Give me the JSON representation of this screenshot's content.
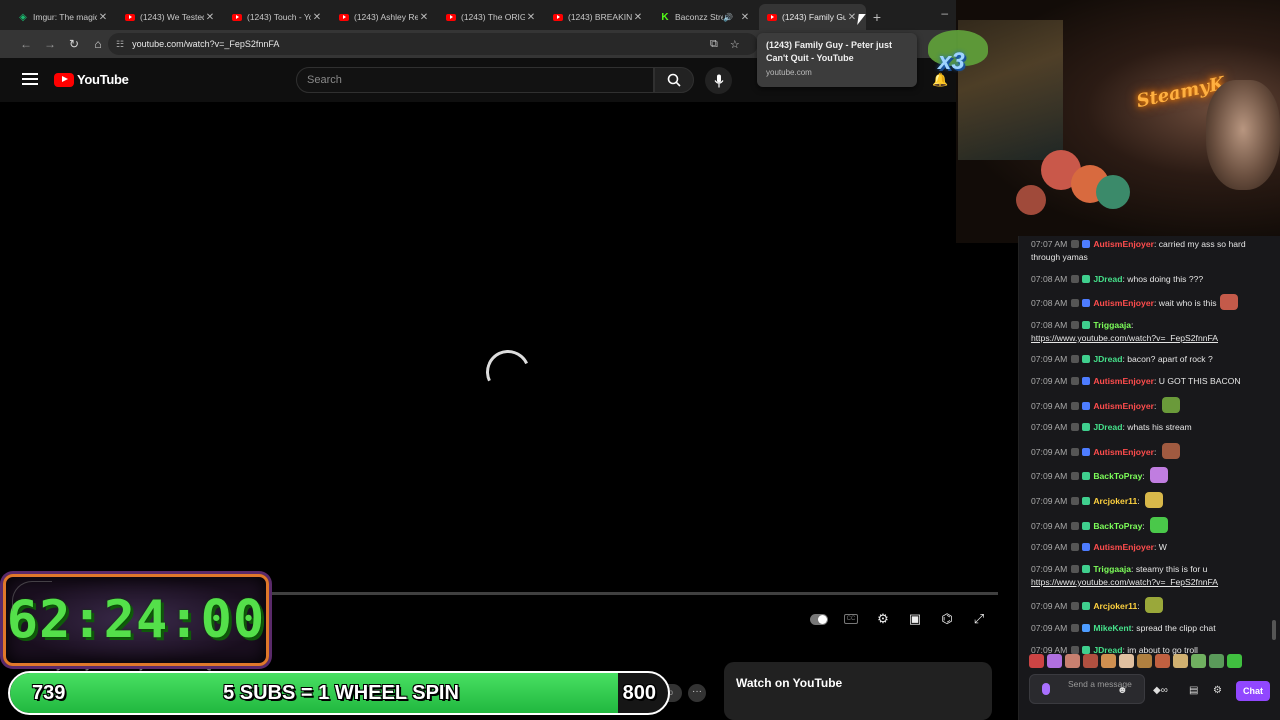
{
  "browser": {
    "tabs": [
      {
        "title": "Imgur: The magic",
        "favicon": "imgur-icon",
        "active": false
      },
      {
        "title": "(1243) We Tested",
        "favicon": "youtube-icon",
        "active": false
      },
      {
        "title": "(1243) Touch - Yo",
        "favicon": "youtube-icon",
        "active": false
      },
      {
        "title": "(1243) Ashley Re",
        "favicon": "youtube-icon",
        "active": false
      },
      {
        "title": "(1243) The ORIGI",
        "favicon": "youtube-icon",
        "active": false
      },
      {
        "title": "(1243) BREAKIN",
        "favicon": "youtube-icon",
        "active": false
      },
      {
        "title": "Baconzz Stre",
        "favicon": "kick-icon",
        "active": false,
        "audio": true
      },
      {
        "title": "(1243) Family Gu",
        "favicon": "youtube-icon",
        "active": true
      }
    ],
    "new_tab": "+",
    "minimize": "–",
    "url": "youtube.com/watch?v=_FepS2fnnFA"
  },
  "tooltip": {
    "title": "(1243) Family Guy - Peter just Can't Quit - YouTube",
    "domain": "youtube.com"
  },
  "youtube": {
    "logo_text": "YouTube",
    "search_placeholder": "Search",
    "video_title": "Family Guy - Peter just Can't Quit",
    "watch_on_youtube": "Watch on YouTube",
    "clip_label": "Clip",
    "more": "···"
  },
  "overlay": {
    "webcam_sign": "SteamyK",
    "emote_multiplier": "x3",
    "timer": "62:24:00",
    "subs_current": "739",
    "subs_goal_text": "5 SUBS = 1 WHEEL SPIN",
    "subs_target": "800",
    "subs_progress": 0.924
  },
  "chat": {
    "messages": [
      {
        "time": "07:07 AM",
        "user": "AutismEnjoyer",
        "color": "#ff4d4d",
        "badge": "#4d7cff",
        "text": "carried my ass so hard through yamas"
      },
      {
        "time": "07:08 AM",
        "user": "JDread",
        "color": "#45e08a",
        "badge": "#3fcf8e",
        "text": "whos doing this ???"
      },
      {
        "time": "07:08 AM",
        "user": "AutismEnjoyer",
        "color": "#ff4d4d",
        "badge": "#4d7cff",
        "text": "wait who is this",
        "emote": "#c45a4a"
      },
      {
        "time": "07:08 AM",
        "user": "Triggaaja",
        "color": "#7dff5a",
        "badge": "#3fcf8e",
        "text": "",
        "link": "https://www.youtube.com/watch?v=_FepS2fnnFA"
      },
      {
        "time": "07:09 AM",
        "user": "JDread",
        "color": "#45e08a",
        "badge": "#3fcf8e",
        "text": "bacon? apart of rock ?"
      },
      {
        "time": "07:09 AM",
        "user": "AutismEnjoyer",
        "color": "#ff4d4d",
        "badge": "#4d7cff",
        "text": "U GOT THIS BACON"
      },
      {
        "time": "07:09 AM",
        "user": "AutismEnjoyer",
        "color": "#ff4d4d",
        "badge": "#4d7cff",
        "text": "",
        "emote": "#6a9a3a"
      },
      {
        "time": "07:09 AM",
        "user": "JDread",
        "color": "#45e08a",
        "badge": "#3fcf8e",
        "text": "whats his stream"
      },
      {
        "time": "07:09 AM",
        "user": "AutismEnjoyer",
        "color": "#ff4d4d",
        "badge": "#4d7cff",
        "text": "",
        "emote": "#a05a40"
      },
      {
        "time": "07:09 AM",
        "user": "BackToPray",
        "color": "#7dff5a",
        "badge": "#3fcf8e",
        "text": "",
        "emote": "#c07de0"
      },
      {
        "time": "07:09 AM",
        "user": "Arcjoker11",
        "color": "#ffd23f",
        "badge": "#3fcf8e",
        "text": "",
        "emote": "#d8b84a"
      },
      {
        "time": "07:09 AM",
        "user": "BackToPray",
        "color": "#7dff5a",
        "badge": "#3fcf8e",
        "text": "",
        "emote": "#4ac84a"
      },
      {
        "time": "07:09 AM",
        "user": "AutismEnjoyer",
        "color": "#ff4d4d",
        "badge": "#4d7cff",
        "text": "W"
      },
      {
        "time": "07:09 AM",
        "user": "Triggaaja",
        "color": "#7dff5a",
        "badge": "#3fcf8e",
        "text": "steamy this is for u",
        "link": "https://www.youtube.com/watch?v=_FepS2fnnFA"
      },
      {
        "time": "07:09 AM",
        "user": "Arcjoker11",
        "color": "#ffd23f",
        "badge": "#3fcf8e",
        "text": "",
        "emote": "#9aa83a"
      },
      {
        "time": "07:09 AM",
        "user": "MikeKent",
        "color": "#45e08a",
        "badge": "#4d9cff",
        "text": "spread the clipp chat"
      },
      {
        "time": "07:09 AM",
        "user": "JDread",
        "color": "#45e08a",
        "badge": "#3fcf8e",
        "text": "im about to go troll"
      }
    ],
    "input_placeholder": "Send a message",
    "chat_button": "Chat",
    "emote_bar_colors": [
      "#c44",
      "#b070e0",
      "#c88070",
      "#b05040",
      "#d09050",
      "#e0c0a0",
      "#b08040",
      "#c06040",
      "#d0b070",
      "#70b060",
      "#5a9a5a",
      "#40c040"
    ]
  },
  "colors": {
    "youtube_red": "#ff0000",
    "subs_green": "#2ecc4a",
    "timer_green": "#54e04a",
    "twitch_purple": "#9147ff"
  }
}
